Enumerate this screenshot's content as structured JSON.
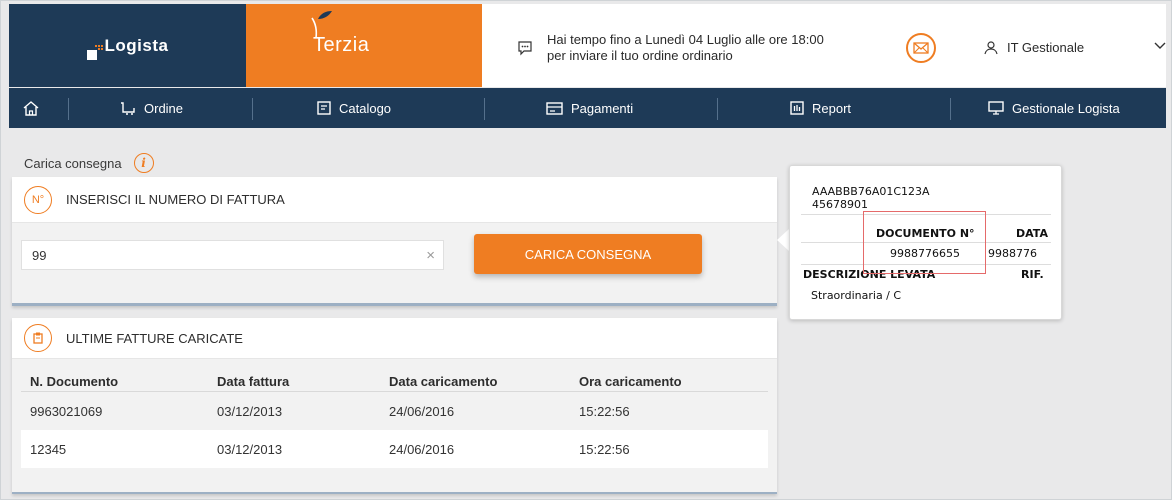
{
  "header": {
    "logista_brand": "Logista",
    "terzia_brand": "Terzia",
    "message_line1": "Hai tempo fino a Lunedì 04 Luglio alle ore 18:00",
    "message_line2": "per inviare il tuo ordine ordinario",
    "user_name": "IT Gestionale",
    "accent_color": "#ef7d22",
    "nav_color": "#1e3a57"
  },
  "nav": {
    "items": [
      {
        "label": "Ordine",
        "icon": "cart-icon"
      },
      {
        "label": "Catalogo",
        "icon": "catalog-icon"
      },
      {
        "label": "Pagamenti",
        "icon": "card-icon"
      },
      {
        "label": "Report",
        "icon": "report-icon"
      },
      {
        "label": "Gestionale Logista",
        "icon": "monitor-icon"
      }
    ]
  },
  "page": {
    "title": "Carica consegna"
  },
  "invoice_form": {
    "badge": "N°",
    "heading": "INSERISCI IL NUMERO DI FATTURA",
    "input_value": "99",
    "clear": "×",
    "button_label": "CARICA CONSEGNA"
  },
  "recent": {
    "heading": "ULTIME FATTURE CARICATE",
    "columns": [
      "N. Documento",
      "Data fattura",
      "Data caricamento",
      "Ora caricamento"
    ],
    "rows": [
      [
        "9963021069",
        "03/12/2013",
        "24/06/2016",
        "15:22:56"
      ],
      [
        "12345",
        "03/12/2013",
        "24/06/2016",
        "15:22:56"
      ]
    ]
  },
  "tooltip": {
    "code_line1": "AAABBB76A01C123A",
    "code_line2": "45678901",
    "documento_label": "DOCUMENTO N°",
    "data_label": "DATA",
    "documento_value": "9988776655",
    "data_value": "9988776",
    "descrizione_label": "DESCRIZIONE LEVATA",
    "rif_label": "RIF.",
    "descrizione_value": "Straordinaria / C"
  }
}
